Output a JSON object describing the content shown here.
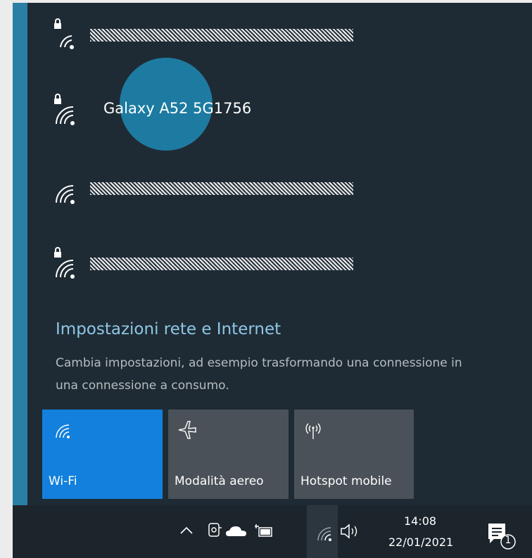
{
  "networks": [
    {
      "name": "",
      "locked": true,
      "obscured": true
    },
    {
      "name": "Galaxy A52 5G1756",
      "locked": true,
      "obscured": false
    },
    {
      "name": "",
      "locked": false,
      "obscured": true
    },
    {
      "name": "",
      "locked": true,
      "obscured": true
    }
  ],
  "settings": {
    "title": "Impostazioni rete e Internet",
    "description": "Cambia impostazioni, ad esempio trasformando una connessione in una connessione a consumo."
  },
  "quick_actions": [
    {
      "label": "Wi-Fi",
      "icon": "wifi-icon",
      "active": true
    },
    {
      "label": "Modalità aereo",
      "icon": "airplane-icon",
      "active": false
    },
    {
      "label": "Hotspot mobile",
      "icon": "hotspot-icon",
      "active": false
    }
  ],
  "taskbar": {
    "time": "14:08",
    "date": "22/01/2021",
    "notification_count": "1"
  },
  "colors": {
    "panel": "#1f2b34",
    "accent": "#1280dc",
    "link": "#8ec7e6"
  }
}
